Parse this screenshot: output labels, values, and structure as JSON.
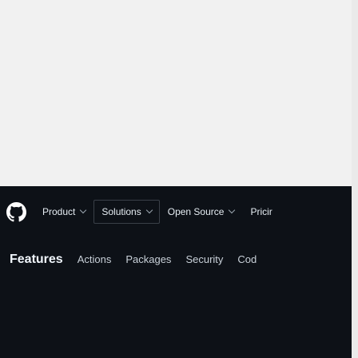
{
  "header": {
    "logo_icon": "github-mark-icon",
    "nav": [
      {
        "label": "Product",
        "has_dropdown": true
      },
      {
        "label": "Solutions",
        "has_dropdown": true
      },
      {
        "label": "Open Source",
        "has_dropdown": true
      },
      {
        "label": "Pricir",
        "has_dropdown": false
      }
    ]
  },
  "subnav": {
    "title": "Features",
    "links": [
      "Actions",
      "Packages",
      "Security",
      "Cod"
    ]
  },
  "colors": {
    "header_bg": "#0d1117",
    "header_text": "#e6edf3",
    "page_bg": "#f1f1f1"
  }
}
